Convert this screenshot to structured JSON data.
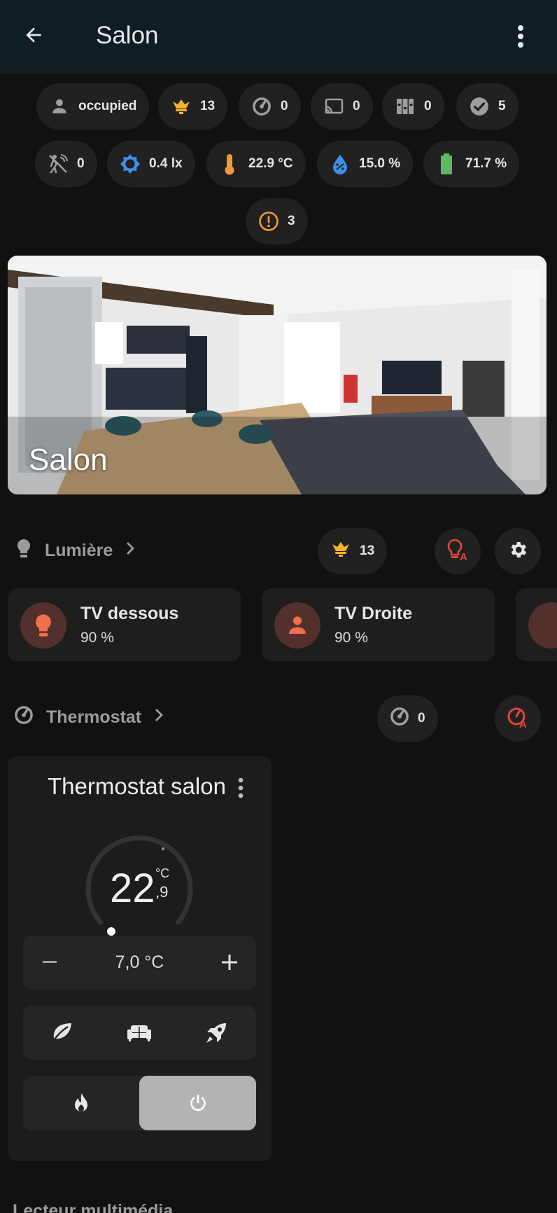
{
  "header": {
    "title": "Salon"
  },
  "badges_row1": [
    {
      "icon": "person-icon",
      "value": "occupied"
    },
    {
      "icon": "chandelier-icon",
      "value": "13"
    },
    {
      "icon": "thermostat-gauge-icon",
      "value": "0"
    },
    {
      "icon": "cast-icon",
      "value": "0"
    },
    {
      "icon": "shutter-icon",
      "value": "0"
    },
    {
      "icon": "check-circle-icon",
      "value": "5"
    }
  ],
  "badges_row2": [
    {
      "icon": "motion-off-icon",
      "value": "0"
    },
    {
      "icon": "illuminance-icon",
      "value": "0.4 lx"
    },
    {
      "icon": "thermometer-icon",
      "value": "22.9 °C"
    },
    {
      "icon": "humidity-icon",
      "value": "15.0 %"
    },
    {
      "icon": "battery-icon",
      "value": "71.7 %"
    }
  ],
  "badges_row3": [
    {
      "icon": "alert-circle-icon",
      "value": "3"
    }
  ],
  "area": {
    "name": "Salon"
  },
  "lights_section": {
    "title": "Lumière",
    "count": "13",
    "tiles": [
      {
        "name": "TV dessous",
        "state": "90 %",
        "icon": "bulb-icon"
      },
      {
        "name": "TV Droite",
        "state": "90 %",
        "icon": "person-icon"
      }
    ]
  },
  "thermostat_section": {
    "title": "Thermostat",
    "count": "0"
  },
  "thermostat_card": {
    "name": "Thermostat salon",
    "current_integer": "22",
    "current_decimal": ",9",
    "unit": "°C",
    "target": "7,0 °C",
    "presets": [
      "eco-leaf-icon",
      "comfort-sofa-icon",
      "boost-rocket-icon"
    ],
    "mode_heat": "fire-icon",
    "mode_off": "power-icon"
  },
  "bottom_section": {
    "title": "Lecteur multimédia"
  },
  "colors": {
    "header_bg": "#101e24",
    "badge_bg": "#212121",
    "amber": "#f7b32b",
    "orange": "#f29a38",
    "blue": "#3d8fe8",
    "green": "#5fb85f",
    "light_accent": "#f0704d",
    "alert_red": "#e0453a"
  }
}
